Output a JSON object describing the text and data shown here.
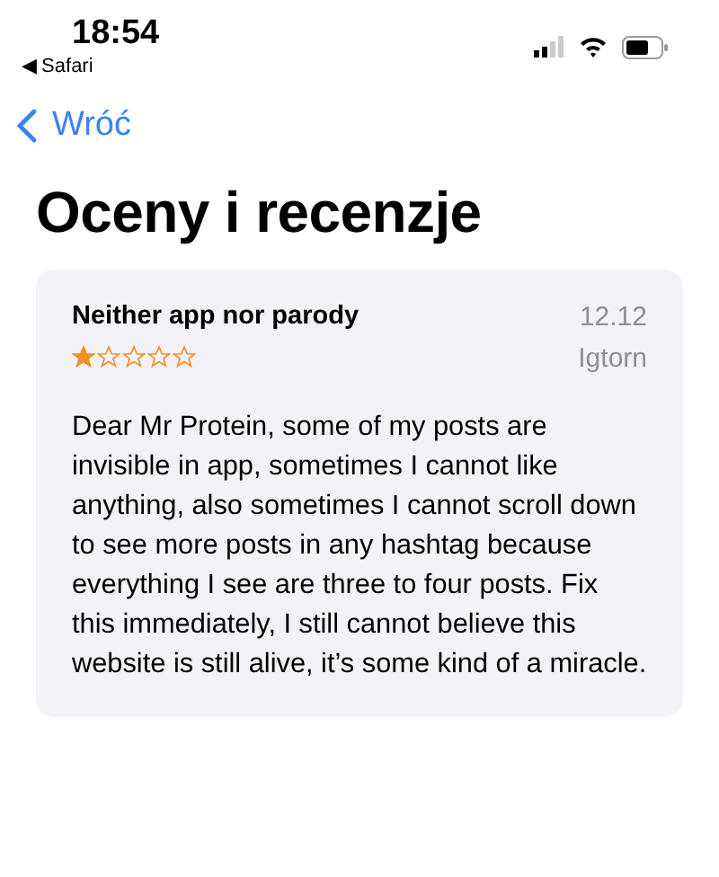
{
  "status_bar": {
    "time": "18:54",
    "back_app": "◀ Safari"
  },
  "nav": {
    "back_label": "Wróć"
  },
  "title": "Oceny i recenzje",
  "review": {
    "title": "Neither app nor parody",
    "date": "12.12",
    "stars": 1,
    "author": "Igtorn",
    "body": "Dear Mr Protein, some of my posts are invisible in app, sometimes I cannot like anything, also sometimes I cannot scroll down to see more posts in any hashtag because everything I see are three to four posts. Fix this immediately, I still cannot believe this website is still alive, it’s some kind of a miracle."
  }
}
